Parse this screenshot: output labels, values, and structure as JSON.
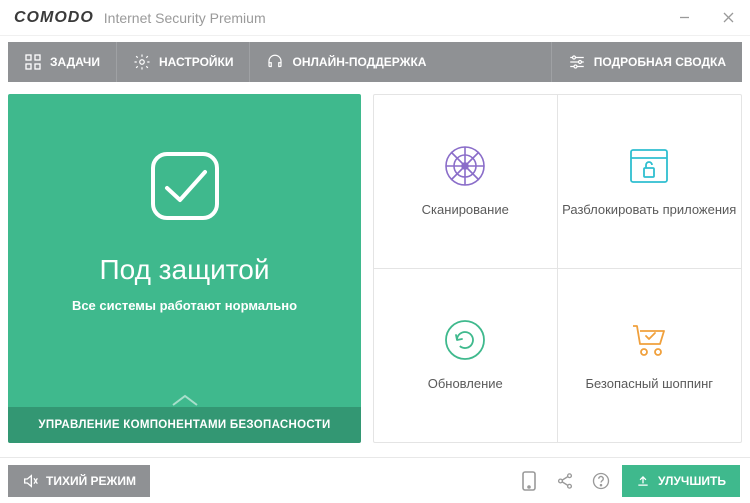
{
  "brand": {
    "name": "COMODO",
    "product": "Internet Security Premium"
  },
  "nav": {
    "tasks": "ЗАДАЧИ",
    "settings": "НАСТРОЙКИ",
    "support": "ОНЛАЙН-ПОДДЕРЖКА",
    "summary": "ПОДРОБНАЯ СВОДКА"
  },
  "status": {
    "title": "Под защитой",
    "subtitle": "Все системы работают нормально",
    "footer": "УПРАВЛЕНИЕ КОМПОНЕНТАМИ БЕЗОПАСНОСТИ"
  },
  "tiles": {
    "scan": "Сканирование",
    "unblock": "Разблокировать приложения",
    "update": "Обновление",
    "shopping": "Безопасный шоппинг"
  },
  "footer": {
    "silent": "ТИХИЙ РЕЖИМ",
    "upgrade": "УЛУЧШИТЬ"
  },
  "colors": {
    "accent_green": "#3fb98d",
    "nav_grey": "#8f9194",
    "tile_orange": "#f0a03c",
    "tile_teal": "#2fbfd0",
    "tile_purple": "#8a6dc9"
  }
}
